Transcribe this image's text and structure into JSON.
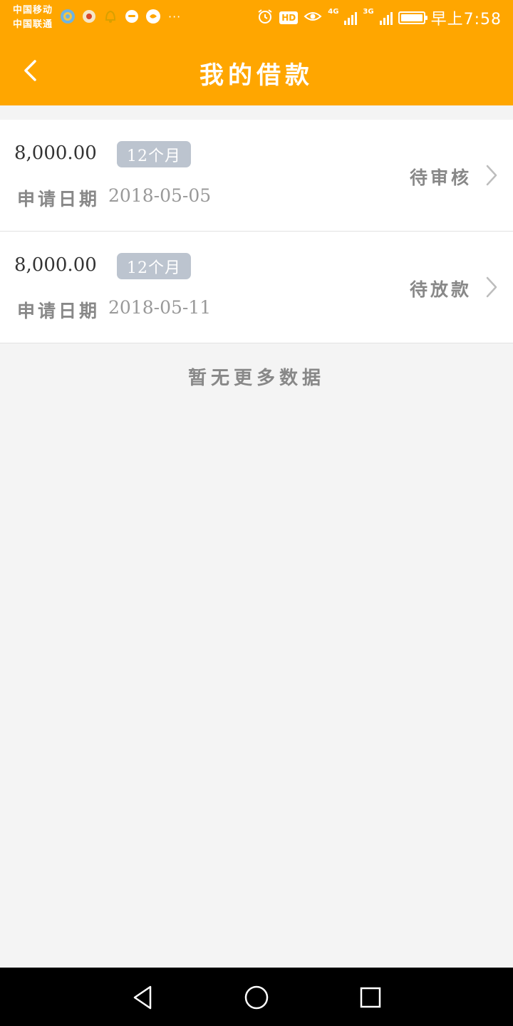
{
  "status_bar": {
    "carrier_1": "中国移动",
    "carrier_2": "中国联通",
    "more_indicator": "···",
    "hd_badge": "HD",
    "network_1": "4G",
    "network_2": "3G",
    "time": "早上7:58",
    "icons": [
      "camera-app-icon",
      "flower-app-icon",
      "bell-app-icon",
      "chat-app-icon",
      "message-app-icon",
      "alarm-icon",
      "eye-icon",
      "signal-icon",
      "battery-icon"
    ]
  },
  "header": {
    "title": "我的借款",
    "back_icon": "chevron-left-icon",
    "background": "#ffa600"
  },
  "loans": [
    {
      "amount": "8,000.00",
      "term": "12个月",
      "date_label": "申请日期",
      "date": "2018-05-05",
      "status": "待审核"
    },
    {
      "amount": "8,000.00",
      "term": "12个月",
      "date_label": "申请日期",
      "date": "2018-05-11",
      "status": "待放款"
    }
  ],
  "footer_text": "暂无更多数据",
  "system_nav": {
    "icons": [
      "back-triangle-icon",
      "home-circle-icon",
      "recents-square-icon"
    ]
  }
}
